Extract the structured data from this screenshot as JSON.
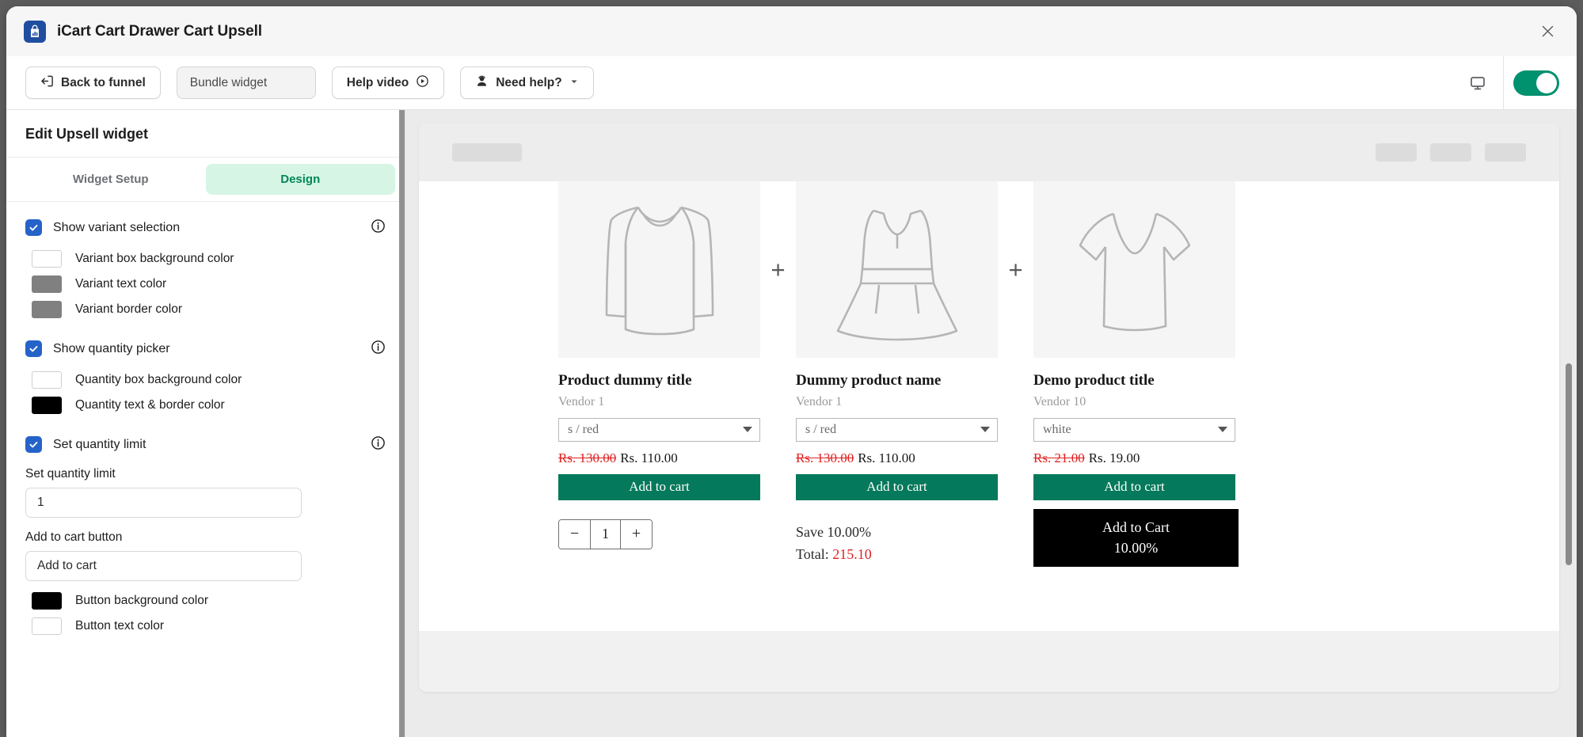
{
  "window": {
    "title": "iCart Cart Drawer Cart Upsell",
    "logo_icon": "chart-bag-icon",
    "close_icon": "close-icon"
  },
  "toolbar": {
    "back_label": "Back to funnel",
    "back_icon": "arrow-left-box-icon",
    "widget_name": "Bundle widget",
    "help_video_label": "Help video",
    "help_video_icon": "play-circle-icon",
    "need_help_label": "Need help?",
    "need_help_icon": "person-headset-icon",
    "need_help_caret": "chevron-down-icon",
    "device_icon": "desktop-monitor-icon",
    "toggle_state": "on",
    "toggle_color": "#00916e"
  },
  "sidebar": {
    "heading": "Edit Upsell widget",
    "tabs": [
      {
        "label": "Widget Setup",
        "active": false
      },
      {
        "label": "Design",
        "active": true
      }
    ],
    "active_tab_color": "#00875a",
    "active_tab_bg": "#d6f5e5",
    "checkbox_color": "#2563c9",
    "options": [
      {
        "label": "Show variant selection",
        "checked": true,
        "info_icon": "info-circle-icon",
        "colors": [
          {
            "label": "Variant box background color",
            "value": "#ffffff"
          },
          {
            "label": "Variant text color",
            "value": "#808080"
          },
          {
            "label": "Variant border color",
            "value": "#808080"
          }
        ]
      },
      {
        "label": "Show quantity picker",
        "checked": true,
        "info_icon": "info-circle-icon",
        "colors": [
          {
            "label": "Quantity box background color",
            "value": "#ffffff"
          },
          {
            "label": "Quantity text & border color",
            "value": "#000000"
          }
        ]
      },
      {
        "label": "Set quantity limit",
        "checked": true,
        "info_icon": "info-circle-icon",
        "colors": []
      }
    ],
    "quantity_limit": {
      "label": "Set quantity limit",
      "value": "1"
    },
    "add_to_cart_button": {
      "label": "Add to cart button",
      "value": "Add to cart"
    },
    "button_colors": [
      {
        "label": "Button background color",
        "value": "#000000"
      },
      {
        "label": "Button text color",
        "value": "#ffffff"
      }
    ]
  },
  "preview": {
    "separator": "+",
    "products": [
      {
        "image_icon": "long-sleeve-shirt-outline-icon",
        "title": "Product dummy title",
        "vendor": "Vendor 1",
        "variant": "s / red",
        "price_old": "Rs. 130.00",
        "price_new": "Rs. 110.00",
        "add_to_cart": "Add to cart"
      },
      {
        "image_icon": "dress-outline-icon",
        "title": "Dummy product name",
        "vendor": "Vendor 1",
        "variant": "s / red",
        "price_old": "Rs. 130.00",
        "price_new": "Rs. 110.00",
        "add_to_cart": "Add to cart"
      },
      {
        "image_icon": "v-neck-tshirt-outline-icon",
        "title": "Demo product title",
        "vendor": "Vendor 10",
        "variant": "white",
        "price_old": "Rs. 21.00",
        "price_new": "Rs. 19.00",
        "add_to_cart": "Add to cart"
      }
    ],
    "quantity": {
      "decrement": "−",
      "value": "1",
      "increment": "+"
    },
    "save_text": "Save 10.00%",
    "total_label": "Total:",
    "total_value": "215.10",
    "final_cta": {
      "line1": "Add to Cart",
      "line2": "10.00%"
    },
    "accent_green": "#05795b",
    "accent_red": "#e02020"
  }
}
